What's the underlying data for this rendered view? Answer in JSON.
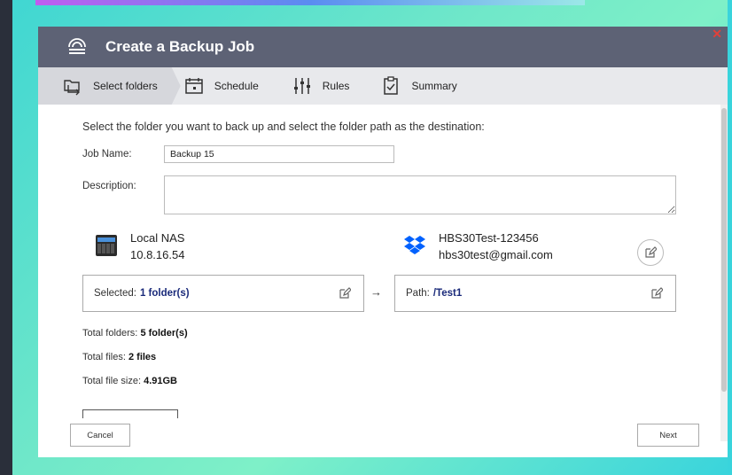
{
  "dialog": {
    "title": "Create a Backup Job",
    "close_glyph": "✕"
  },
  "steps": [
    {
      "label": "Select folders",
      "icon": "folder-arrow-icon",
      "active": true
    },
    {
      "label": "Schedule",
      "icon": "calendar-icon",
      "active": false
    },
    {
      "label": "Rules",
      "icon": "sliders-icon",
      "active": false
    },
    {
      "label": "Summary",
      "icon": "clipboard-icon",
      "active": false
    }
  ],
  "form": {
    "instruction": "Select the folder you want to back up and select the folder path as the destination:",
    "job_name_label": "Job Name:",
    "job_name_value": "Backup 15",
    "description_label": "Description:",
    "description_value": ""
  },
  "source": {
    "name": "Local NAS",
    "ip": "10.8.16.54",
    "icon": "nas-device-icon",
    "selected_label": "Selected:",
    "selected_value": "1 folder(s)"
  },
  "destination": {
    "name": "HBS30Test-123456",
    "account": "hbs30test@gmail.com",
    "icon": "dropbox-icon",
    "path_label": "Path:",
    "path_value": "/Test1"
  },
  "arrow_glyph": "→",
  "stats": {
    "total_folders_label": "Total folders:",
    "total_folders_value": "5 folder(s)",
    "total_files_label": "Total files:",
    "total_files_value": "2 files",
    "total_size_label": "Total file size:",
    "total_size_value": "4.91GB"
  },
  "buttons": {
    "cancel": "Cancel",
    "next": "Next"
  },
  "colors": {
    "titlebar": "#5d6275",
    "accent_value": "#1a2a7a",
    "close": "#e0413a",
    "dropbox": "#0061fe"
  }
}
